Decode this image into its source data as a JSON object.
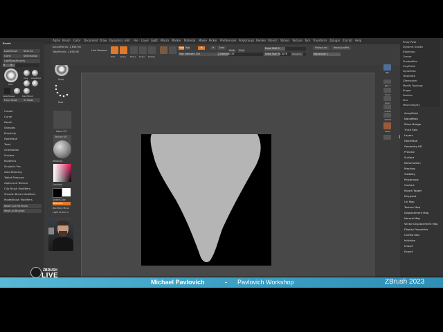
{
  "app": {
    "name": "ZBrush 2023"
  },
  "menu": [
    "Alpha",
    "Brush",
    "Color",
    "Document",
    "Draw",
    "Dynamics",
    "Edit",
    "File",
    "Layer",
    "Light",
    "Macro",
    "Marker",
    "Material",
    "Movie",
    "Picker",
    "Preferences",
    "PolyGroups",
    "Render",
    "Stencil",
    "Stroke",
    "Texture",
    "Tool",
    "Transform",
    "Zplugin",
    "Zscript",
    "Help"
  ],
  "left_panel": {
    "title": "Brush",
    "buttons": [
      "Load Brush",
      "Save As",
      "Clone",
      "SelectLasso",
      "LightBox▸Brushes"
    ],
    "brush_size_label": "R",
    "brush_size_value": "78",
    "brushes": [
      "Plain",
      "Clay",
      "ClayBuild",
      "Standard",
      "Move",
      "Elastic",
      "SelectLasso",
      "SmoothBrush",
      "DamStand",
      "Select"
    ],
    "sub_buttons": [
      "Frone Mesh",
      "Tri Mode"
    ],
    "menu_items": [
      "Create",
      "Curve",
      "Depth",
      "Samples",
      "Elasticity",
      "FiberMesh",
      "Twist",
      "Orientation",
      "Surface",
      "Modifiers",
      "Sculptris Pro",
      "Auto Masking",
      "Tablet Pressure",
      "Alpha and Texture",
      "Clip Brush Modifiers",
      "Smooth Brush Modifiers",
      "ModelBrush Modifiers"
    ],
    "reset_buttons": [
      "Reset Current Brush",
      "Reset All Brushes"
    ]
  },
  "shelf": {
    "items": [
      "Paint",
      "Dots",
      "Alpha Off",
      "Texture Off",
      "ZMatCap"
    ],
    "gradient_label": "Gradient",
    "switch_label": "SwitchColor",
    "alternate_label": "Alternate",
    "backface_label": "Backface Mask",
    "fill_label": "Light Screen",
    "fill_value": "0"
  },
  "topbar": {
    "active_points": "ActivePoints: 1,658 Mil",
    "total_points": "TotalPoints: 1,658 Mil",
    "lightbox": "Live Boolean",
    "buttons": [
      "Edit",
      "Draw",
      "Move",
      "Scale",
      "Rotate"
    ],
    "mrgb": "Mrgb",
    "rgb": "Rgb",
    "m": "M",
    "zadd": "Zadd",
    "zsub": "Zsub",
    "zcut": "Zcut",
    "rgb_intensity": "Rgb Intensity 100",
    "z_intensity": "Z Intensity 25",
    "focal_shift": "Focal Shift 0",
    "draw_size": "Draw Size 78.3278",
    "dynamic": "Dynamic",
    "replay_last": "ReplayLast",
    "replay_last_rel": "ReplayLastRel",
    "adjust_last": "AdjustLast 1"
  },
  "right_shelf": [
    "Bpr",
    "SPix 3",
    "Scroll",
    "Zoom",
    "Actual",
    "AAHalf",
    "Persp",
    "Floor",
    "Local",
    "Frame",
    "Move",
    "Zoom3D",
    "Rotate",
    "Line Fill",
    "Transp",
    "Solo"
  ],
  "right_tray": {
    "sub_items": [
      "Proxy Pose",
      "Dynamic Subdiv",
      "EdgeLoop",
      "Crease",
      "ShadowBox",
      "ClayPolish",
      "DynaMesh",
      "Tessimate",
      "ZRemesher",
      "Modify Topology",
      "Stager",
      "Position",
      "Size",
      "MeshIntegrity"
    ],
    "items": [
      "ArrayMesh",
      "NanoMesh",
      "Slime Bridge",
      "Thick Skin",
      "Layers",
      "FiberMesh",
      "Geometry HD",
      "Preview",
      "Surface",
      "Deformation",
      "Masking",
      "Visibility",
      "Polygroups",
      "Contact",
      "Morph Target",
      "Polypaint",
      "UV Map",
      "Texture Map",
      "Displacement Map",
      "Normal Map",
      "Vector Displacement Map",
      "Display Properties",
      "Unified Skin",
      "Initialize",
      "Import",
      "Export"
    ]
  },
  "banner": {
    "presenter": "Michael Pavlovich",
    "separator": "-",
    "workshop": "Pavlovich Workshop",
    "product": "ZBrush 2023"
  },
  "logo": {
    "line1": "ZBRUSH",
    "line2": "LIVE"
  },
  "colors": {
    "accent": "#e0792a",
    "banner": "#3fa4c8",
    "canvas_bg": "#484848",
    "document_bg": "#000000",
    "shape_fill": "#b5b5b5"
  }
}
